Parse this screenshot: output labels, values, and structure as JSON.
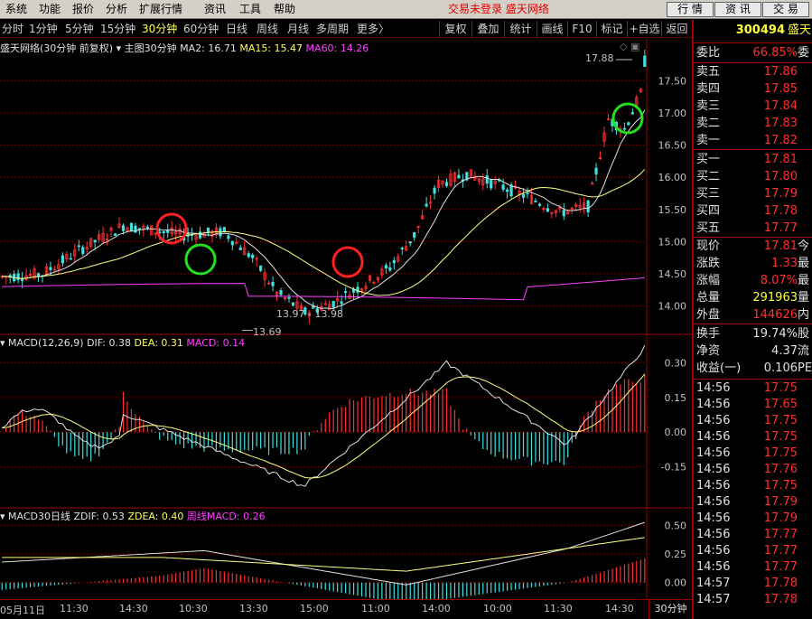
{
  "menu": {
    "items": [
      "系统",
      "功能",
      "报价",
      "分析",
      "扩展行情",
      "资讯",
      "工具",
      "帮助"
    ],
    "status": "交易未登录  盛天网络",
    "right_buttons": [
      "行 情",
      "资 讯",
      "交 易"
    ]
  },
  "toolbar": {
    "periods": [
      "分时",
      "1分钟",
      "5分钟",
      "15分钟",
      "30分钟",
      "60分钟",
      "日线",
      "周线",
      "月线",
      "多周期",
      "更多〉"
    ],
    "active_period": "30分钟",
    "tools": [
      "复权",
      "叠加",
      "统计",
      "画线",
      "F10",
      "标记",
      "+自选",
      "返回"
    ]
  },
  "main_pane": {
    "stock_title": "盛天网络(30分钟 前复权)",
    "indicator_name": "主图30分钟",
    "ma2": "MA2: 16.71",
    "ma15": "MA15: 15.47",
    "ma60": "MA60: 14.26",
    "y_ticks": [
      "17.50",
      "17.00",
      "16.50",
      "16.00",
      "15.50",
      "15.00",
      "14.50",
      "14.00"
    ],
    "high_label": "17.88",
    "low_label": "13.69",
    "range_label": "13.97 - 13.98"
  },
  "macd_pane": {
    "name": "MACD(12,26,9)",
    "dif": "DIF: 0.38",
    "dea": "DEA: 0.31",
    "macd": "MACD: 0.14",
    "y_ticks": [
      "0.30",
      "0.15",
      "0.00",
      "-0.15"
    ]
  },
  "macd30_pane": {
    "name": "MACD30日线",
    "zdif": "ZDIF: 0.53",
    "zdea": "ZDEA: 0.40",
    "weekly": "周线MACD: 0.26",
    "y_ticks": [
      "0.50",
      "0.25",
      "0.00"
    ]
  },
  "time_axis": {
    "labels": [
      "05月11日",
      "11:30",
      "14:30",
      "10:30",
      "13:30",
      "15:00",
      "11:00",
      "14:00",
      "10:00",
      "11:30",
      "14:30"
    ],
    "period_tag": "30分钟"
  },
  "right_panel": {
    "code": "300494",
    "name_short": "盛天",
    "weibi_label": "委比",
    "weibi_value": "66.85%",
    "weibi_extra": "委",
    "asks": [
      {
        "label": "卖五",
        "price": "17.86"
      },
      {
        "label": "卖四",
        "price": "17.85"
      },
      {
        "label": "卖三",
        "price": "17.84"
      },
      {
        "label": "卖二",
        "price": "17.83"
      },
      {
        "label": "卖一",
        "price": "17.82"
      }
    ],
    "bids": [
      {
        "label": "买一",
        "price": "17.81"
      },
      {
        "label": "买二",
        "price": "17.80"
      },
      {
        "label": "买三",
        "price": "17.79"
      },
      {
        "label": "买四",
        "price": "17.78"
      },
      {
        "label": "买五",
        "price": "17.77"
      }
    ],
    "stats": [
      {
        "label": "现价",
        "value": "17.81",
        "extra": "今",
        "color": "red"
      },
      {
        "label": "涨跌",
        "value": "1.33",
        "extra": "最",
        "color": "red"
      },
      {
        "label": "涨幅",
        "value": "8.07%",
        "extra": "最",
        "color": "red"
      },
      {
        "label": "总量",
        "value": "291963",
        "extra": "量",
        "color": "ylw"
      },
      {
        "label": "外盘",
        "value": "144626",
        "extra": "内",
        "color": "red"
      }
    ],
    "stats2": [
      {
        "label": "换手",
        "value": "19.74%",
        "extra": "股",
        "color": "w"
      },
      {
        "label": "净资",
        "value": "4.37",
        "extra": "流",
        "color": "w"
      },
      {
        "label": "收益(一)",
        "value": "0.106",
        "extra": "PE",
        "color": "w"
      }
    ],
    "ticks": [
      {
        "time": "14:56",
        "price": "17.75"
      },
      {
        "time": "14:56",
        "price": "17.65"
      },
      {
        "time": "14:56",
        "price": "17.75"
      },
      {
        "time": "14:56",
        "price": "17.75"
      },
      {
        "time": "14:56",
        "price": "17.75"
      },
      {
        "time": "14:56",
        "price": "17.76"
      },
      {
        "time": "14:56",
        "price": "17.75"
      },
      {
        "time": "14:56",
        "price": "17.79"
      },
      {
        "time": "14:56",
        "price": "17.79"
      },
      {
        "time": "14:56",
        "price": "17.77"
      },
      {
        "time": "14:56",
        "price": "17.77"
      },
      {
        "time": "14:56",
        "price": "17.77"
      },
      {
        "time": "14:57",
        "price": "17.78"
      },
      {
        "time": "14:57",
        "price": "17.78"
      }
    ]
  },
  "colors": {
    "up": "#ff3030",
    "down": "#40e0e0",
    "ma2": "#e0e0e0",
    "ma15": "#ffff80",
    "ma60": "#ff40ff",
    "grid": "#a00000",
    "annot_red": "#ff2020",
    "annot_green": "#20e020"
  }
}
